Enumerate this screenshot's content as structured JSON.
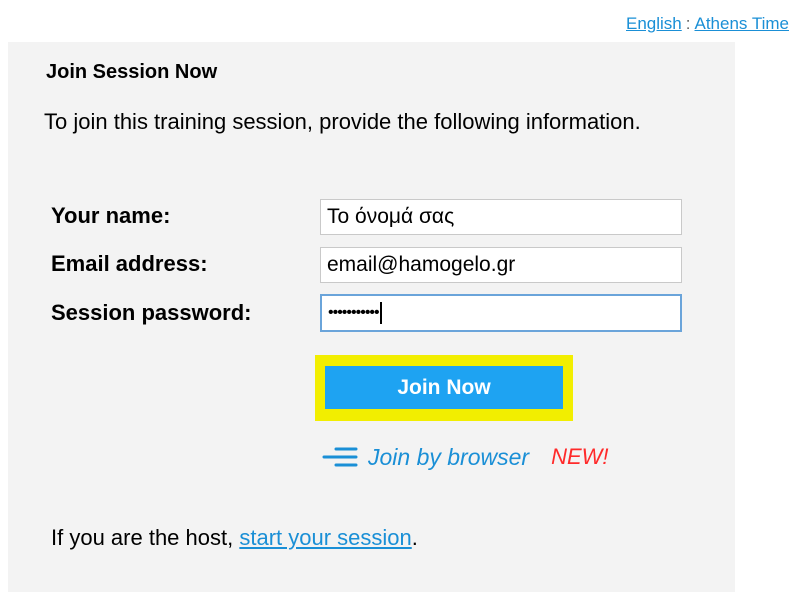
{
  "topbar": {
    "language_link": "English",
    "separator": ":",
    "timezone_link": "Athens Time"
  },
  "panel": {
    "title": "Join Session Now",
    "intro": "To join this training session, provide the following information."
  },
  "form": {
    "name_label": "Your name:",
    "name_value": "Το όνομά σας",
    "email_label": "Email address:",
    "email_value": "email@hamogelo.gr",
    "password_label": "Session password:",
    "password_mask": "•••••••••••"
  },
  "actions": {
    "join_button": "Join Now",
    "join_browser_link": "Join by browser",
    "new_badge": "NEW!",
    "highlight_color": "#f2ee00",
    "button_color": "#1ea3f2"
  },
  "footer": {
    "host_text": "If you are the host, ",
    "start_link": "start your session",
    "trailing": "."
  }
}
